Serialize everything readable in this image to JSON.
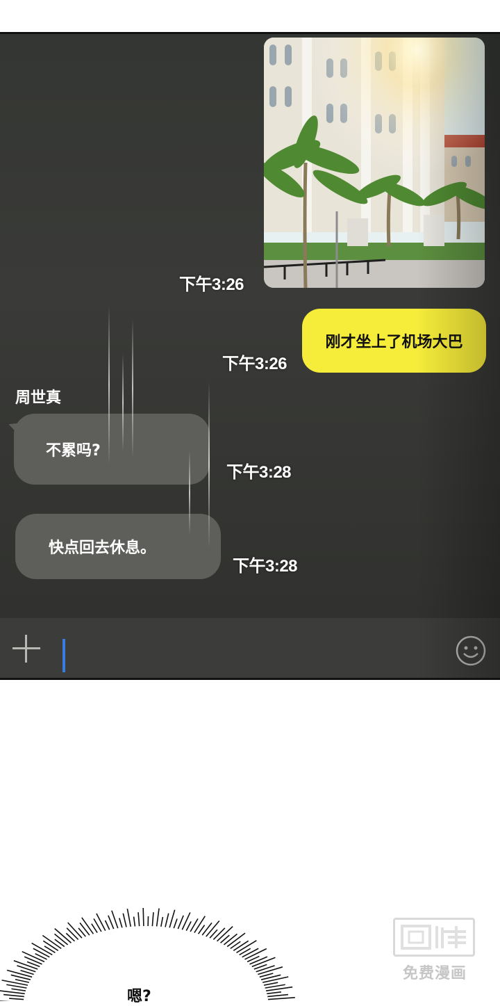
{
  "chat": {
    "messages": [
      {
        "type": "photo",
        "time": "下午3:26"
      },
      {
        "type": "text",
        "from": "me",
        "text": "刚才坐上了机场大巴",
        "time": "下午3:26"
      },
      {
        "type": "text",
        "from": "other",
        "sender": "周世真",
        "text": "不累吗?",
        "time": "下午3:28"
      },
      {
        "type": "text",
        "from": "other",
        "text": "快点回去休息。",
        "time": "下午3:28"
      }
    ],
    "input": {
      "value": ""
    },
    "colors": {
      "my_bubble": "#f6ec3a",
      "other_bubble": "#5e5f5b",
      "cursor": "#3a7de0"
    }
  },
  "scene": {
    "speech": "嗯?"
  },
  "logo": {
    "mark": "画涯",
    "caption": "免费漫画"
  },
  "icons": [
    "plus-icon",
    "smile-icon"
  ]
}
